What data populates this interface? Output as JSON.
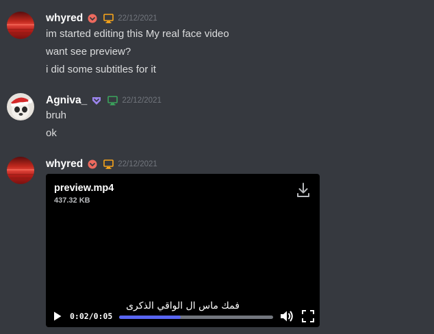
{
  "messages": [
    {
      "username": "whyred",
      "username_color": "#ffffff",
      "avatar_icon": "red-sea-avatar",
      "badge_icon": "nitro-boost-badge-icon",
      "badge_color": "#ed6a5e",
      "device_icon": "desktop-icon",
      "device_color": "#faa61a",
      "timestamp": "22/12/2021",
      "lines": [
        "im started editing this My real face video",
        "want see preview?",
        "i did some subtitles for it"
      ]
    },
    {
      "username": "Agniva_",
      "username_color": "#ffffff",
      "avatar_icon": "santa-hat-avatar",
      "badge_icon": "shield-badge-icon",
      "badge_color": "#9b84ec",
      "device_icon": "desktop-icon",
      "device_color": "#3ba55d",
      "timestamp": "22/12/2021",
      "lines": [
        "bruh",
        "ok"
      ]
    },
    {
      "username": "whyred",
      "username_color": "#ffffff",
      "avatar_icon": "red-sea-avatar",
      "badge_icon": "nitro-boost-badge-icon",
      "badge_color": "#ed6a5e",
      "device_icon": "desktop-icon",
      "device_color": "#faa61a",
      "timestamp": "22/12/2021",
      "attachment": {
        "file_name": "preview.mp4",
        "file_size": "437.32 KB",
        "download_icon": "download-icon",
        "subtitle": "فمك ماس ال الواقي الذكرى",
        "current_time": "0:02",
        "duration": "0:05",
        "time_separator": "/",
        "progress_fraction": 0.4,
        "progress_color": "#5865f2",
        "play_icon": "play-icon",
        "volume_icon": "volume-icon",
        "fullscreen_icon": "fullscreen-icon"
      }
    }
  ],
  "colors": {
    "background": "#36393f",
    "text": "#dcddde",
    "timestamp": "#72767d"
  }
}
